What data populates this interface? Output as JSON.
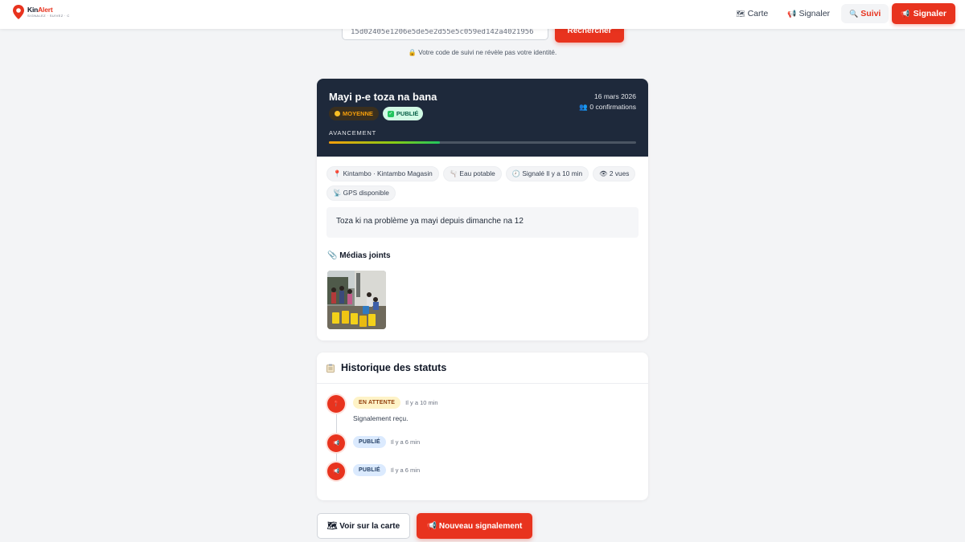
{
  "brand": {
    "name_part1": "Kin",
    "name_part2": "Alert",
    "tagline": "SIGNALEZ · SUIVEZ · C"
  },
  "nav": {
    "map_icon": "map-icon",
    "map_label": "Carte",
    "report_icon": "megaphone-icon",
    "report_label": "Signaler",
    "track_icon": "search-icon",
    "track_label": "Suivi",
    "cta_icon": "megaphone-icon",
    "cta_label": "Signaler"
  },
  "search": {
    "value": "15d02405e1206e5de5e2d55e5c059ed142a4021956",
    "button_label": "Rechercher",
    "privacy_note": "🔒 Votre code de suivi ne révèle pas votre identité."
  },
  "report": {
    "title": "Mayi p-e toza na bana",
    "severity": "MOYENNE",
    "status": "PUBLIÉ",
    "date": "16 mars 2026",
    "confirmations": "👥 0 confirmations",
    "progress_label": "AVANCEMENT",
    "progress": 0.36,
    "chips": [
      "📍 Kintambo · Kintambo Magasin",
      "🫗 Eau potable",
      "🕘 Signalé Il y a 10 min",
      "👁 2 vues",
      "📡 GPS disponible"
    ],
    "description": "Toza ki na problème ya mayi depuis dimanche na 12",
    "media_title": "📎 Médias joints"
  },
  "history": {
    "title": "Historique des statuts",
    "icon": "clipboard-icon",
    "items": [
      {
        "status": "EN ATTENTE",
        "time": "Il y a 10 min",
        "note": "Signalement reçu.",
        "icon": "pin-icon",
        "variant": "wait"
      },
      {
        "status": "PUBLIÉ",
        "time": "Il y a 6 min",
        "note": "",
        "icon": "megaphone-icon",
        "variant": "pub"
      },
      {
        "status": "PUBLIÉ",
        "time": "Il y a 6 min",
        "note": "",
        "icon": "megaphone-icon",
        "variant": "pub"
      }
    ]
  },
  "actions": {
    "map_button": "🗺 Voir sur la carte",
    "new_button": "📢 Nouveau signalement"
  },
  "colors": {
    "accent": "#e8331e",
    "header_dark": "#1e293b",
    "background": "#f3f4f6"
  }
}
